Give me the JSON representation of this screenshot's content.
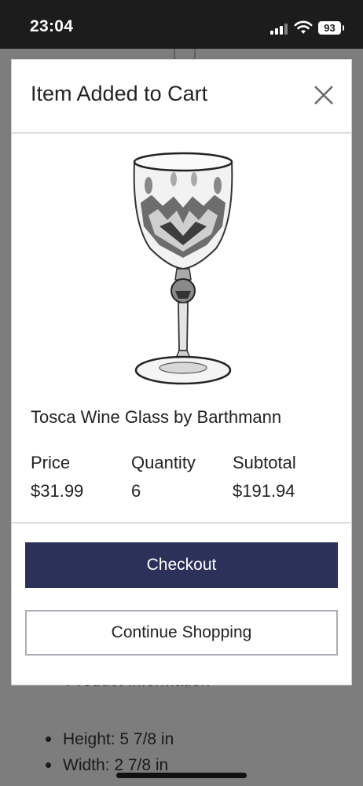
{
  "status_bar": {
    "time": "23:04",
    "battery": "93"
  },
  "modal": {
    "title": "Item Added to Cart",
    "product_name": "Tosca Wine Glass by Barthmann",
    "columns": [
      {
        "label": "Price",
        "value": "$31.99"
      },
      {
        "label": "Quantity",
        "value": "6"
      },
      {
        "label": "Subtotal",
        "value": "$191.94"
      }
    ],
    "checkout_label": "Checkout",
    "continue_label": "Continue Shopping",
    "colors": {
      "checkout_bg": "#2c3159",
      "overlay": "#7d7d7d"
    }
  },
  "background_page": {
    "section_heading": "Product Information",
    "specs": [
      "Height: 5 7/8 in",
      "Width: 2 7/8 in"
    ]
  }
}
